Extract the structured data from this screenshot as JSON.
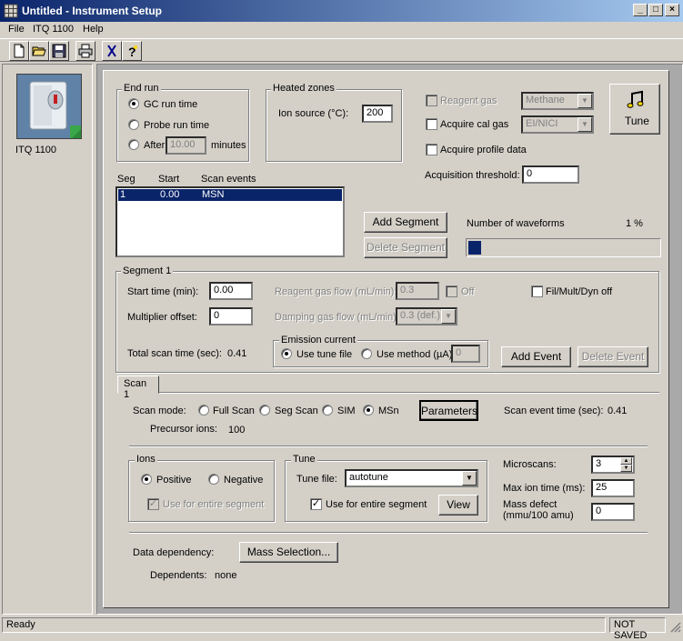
{
  "window": {
    "title": "Untitled - Instrument Setup"
  },
  "menu": [
    "File",
    "ITQ 1100",
    "Help"
  ],
  "toolbar": {
    "icons": [
      "new-document-icon",
      "open-folder-icon",
      "save-disk-icon",
      "print-icon",
      "cut-icon",
      "help-icon"
    ]
  },
  "instrument": {
    "label": "ITQ 1100"
  },
  "end_run": {
    "title": "End run",
    "gc": "GC run time",
    "probe": "Probe run time",
    "after": "After",
    "after_value": "10.00",
    "minutes": "minutes"
  },
  "heated_zones": {
    "title": "Heated zones",
    "ion_source_label": "Ion source (°C):",
    "ion_source_value": "200"
  },
  "reagent": {
    "label": "Reagent gas",
    "value": "Methane"
  },
  "cal_gas": {
    "label": "Acquire cal gas",
    "value": "EI/NICI"
  },
  "profile": {
    "label": "Acquire profile data"
  },
  "tune_button": {
    "label": "Tune"
  },
  "threshold": {
    "label": "Acquisition threshold:",
    "value": "0"
  },
  "segments": {
    "headers": [
      "Seg",
      "Start",
      "Scan events"
    ],
    "rows": [
      [
        "1",
        "0.00",
        "MSN"
      ]
    ]
  },
  "buttons": {
    "add_segment": "Add Segment",
    "delete_segment": "Delete Segment",
    "add_event": "Add Event",
    "delete_event": "Delete Event",
    "parameters": "Parameters",
    "view": "View",
    "mass_selection": "Mass Selection..."
  },
  "waveforms": {
    "label": "Number of waveforms",
    "value": "1 %",
    "fraction": 0.01
  },
  "segment1": {
    "title": "Segment 1",
    "start_time_label": "Start time (min):",
    "start_time_value": "0.00",
    "multiplier_label": "Multiplier offset:",
    "multiplier_value": "0",
    "reagent_flow_label": "Reagent gas flow (mL/min):",
    "reagent_flow_value": "0.3",
    "off_label": "Off",
    "damping_label": "Damping gas flow (mL/min):",
    "damping_value": "0.3 (def.)",
    "fil_label": "Fil/Mult/Dyn off",
    "total_scan_label": "Total scan time (sec):",
    "total_scan_value": "0.41",
    "emission": {
      "title": "Emission current",
      "use_tune": "Use tune file",
      "use_method": "Use method (µA):",
      "method_value": "0"
    }
  },
  "scan1": {
    "tab": "Scan 1",
    "scan_mode_label": "Scan mode:",
    "modes": [
      "Full Scan",
      "Seg Scan",
      "SIM",
      "MSn"
    ],
    "precursor_label": "Precursor ions:",
    "precursor_value": "100",
    "event_time_label": "Scan event time (sec):",
    "event_time_value": "0.41",
    "ions": {
      "title": "Ions",
      "positive": "Positive",
      "negative": "Negative",
      "use_entire": "Use for entire segment"
    },
    "tune": {
      "title": "Tune",
      "file_label": "Tune file:",
      "file_value": "autotune",
      "use_entire": "Use for entire segment"
    },
    "microscans_label": "Microscans:",
    "microscans_value": "3",
    "max_ion_label": "Max ion time (ms):",
    "max_ion_value": "25",
    "mass_defect_label1": "Mass defect",
    "mass_defect_label2": "(mmu/100 amu)",
    "mass_defect_value": "0",
    "data_dep_label": "Data dependency:",
    "dependents_label": "Dependents:",
    "dependents_value": "none"
  },
  "status": {
    "left": "Ready",
    "right": "NOT SAVED"
  },
  "colors": {
    "title_start": "#0a246a",
    "title_end": "#a6caf0",
    "progress": "#0a246a",
    "selection": "#0a246a"
  }
}
